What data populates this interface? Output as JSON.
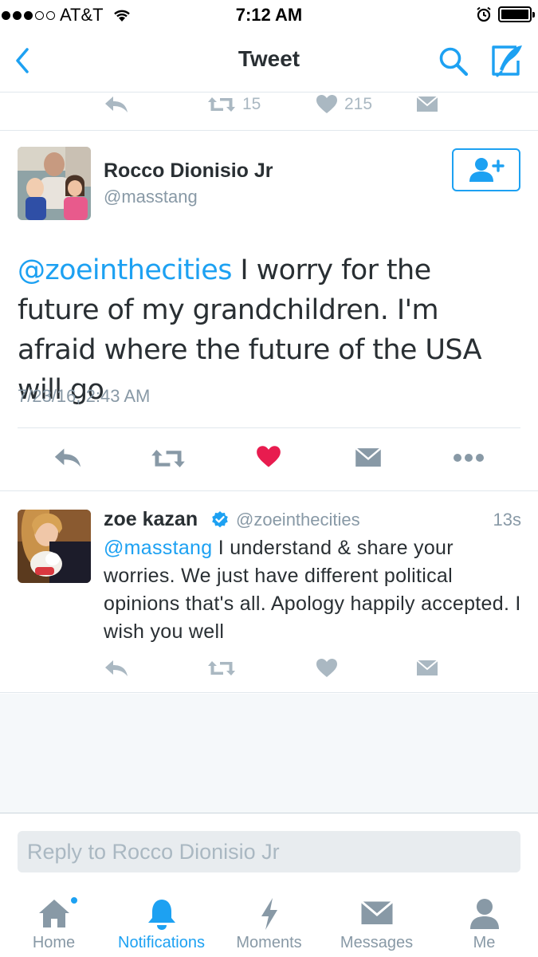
{
  "status_bar": {
    "carrier": "AT&T",
    "time": "7:12 AM"
  },
  "nav": {
    "title": "Tweet"
  },
  "previous_tweet": {
    "retweets": "15",
    "likes": "215"
  },
  "main_tweet": {
    "author_name": "Rocco Dionisio Jr",
    "author_handle": "@masstang",
    "mention": "@zoeinthecities",
    "text": " I worry for the future of my grandchildren. I'm afraid where the future of the USA will go",
    "timestamp": "7/23/16, 2:43 AM",
    "liked": true
  },
  "reply_tweet": {
    "author_name": "zoe kazan",
    "author_handle": "@zoeinthecities",
    "verified": true,
    "age": "13s",
    "mention": "@masstang",
    "text": " I understand & share your worries. We just have different political opinions that's all. Apology happily accepted. I wish you well"
  },
  "reply_box": {
    "placeholder": "Reply to Rocco Dionisio Jr"
  },
  "tabs": [
    {
      "label": "Home",
      "icon": "home-icon",
      "active": false
    },
    {
      "label": "Notifications",
      "icon": "bell-icon",
      "active": true
    },
    {
      "label": "Moments",
      "icon": "lightning-icon",
      "active": false
    },
    {
      "label": "Messages",
      "icon": "envelope-icon",
      "active": false
    },
    {
      "label": "Me",
      "icon": "person-icon",
      "active": false
    }
  ],
  "colors": {
    "accent": "#1da1f2",
    "like": "#e81c4f",
    "secondary_text": "#8899a6",
    "icon_gray": "#aab8c2"
  }
}
